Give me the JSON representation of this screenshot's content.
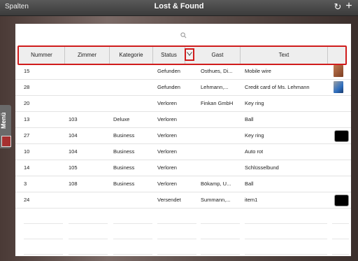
{
  "topbar": {
    "left_label": "Spalten",
    "title": "Lost & Found",
    "sync_icon": "sync-icon",
    "add_icon": "plus-icon"
  },
  "side_menu": {
    "label": "Menü"
  },
  "search": {
    "icon": "search-icon"
  },
  "table": {
    "columns": [
      "Nummer",
      "Zimmer",
      "Kategorie",
      "Status",
      "Gast",
      "Text"
    ],
    "rows": [
      {
        "nummer": "15",
        "zimmer": "",
        "kategorie": "",
        "status": "Gefunden",
        "gast": "Osthues, Di...",
        "text": "Mobile wire",
        "thumb": "photo-wire"
      },
      {
        "nummer": "28",
        "zimmer": "",
        "kategorie": "",
        "status": "Gefunden",
        "gast": "Lehmann,...",
        "text": "Credit card of Ms. Lehmann",
        "thumb": "photo-card"
      },
      {
        "nummer": "20",
        "zimmer": "",
        "kategorie": "",
        "status": "Verloren",
        "gast": "Finkan GmbH",
        "text": "Key ring",
        "thumb": ""
      },
      {
        "nummer": "13",
        "zimmer": "103",
        "kategorie": "Deluxe",
        "status": "Verloren",
        "gast": "",
        "text": "Ball",
        "thumb": ""
      },
      {
        "nummer": "27",
        "zimmer": "104",
        "kategorie": "Business",
        "status": "Verloren",
        "gast": "",
        "text": "Key ring",
        "thumb": "black"
      },
      {
        "nummer": "10",
        "zimmer": "104",
        "kategorie": "Business",
        "status": "Verloren",
        "gast": "",
        "text": "Auto rot",
        "thumb": ""
      },
      {
        "nummer": "14",
        "zimmer": "105",
        "kategorie": "Business",
        "status": "Verloren",
        "gast": "",
        "text": "Schlüsselbund",
        "thumb": ""
      },
      {
        "nummer": "3",
        "zimmer": "108",
        "kategorie": "Business",
        "status": "Verloren",
        "gast": "Bökamp, U...",
        "text": "Ball",
        "thumb": ""
      },
      {
        "nummer": "24",
        "zimmer": "",
        "kategorie": "",
        "status": "Versendet",
        "gast": "Summann,...",
        "text": "item1",
        "thumb": "black"
      }
    ]
  },
  "colors": {
    "highlight": "#d01c1c"
  }
}
